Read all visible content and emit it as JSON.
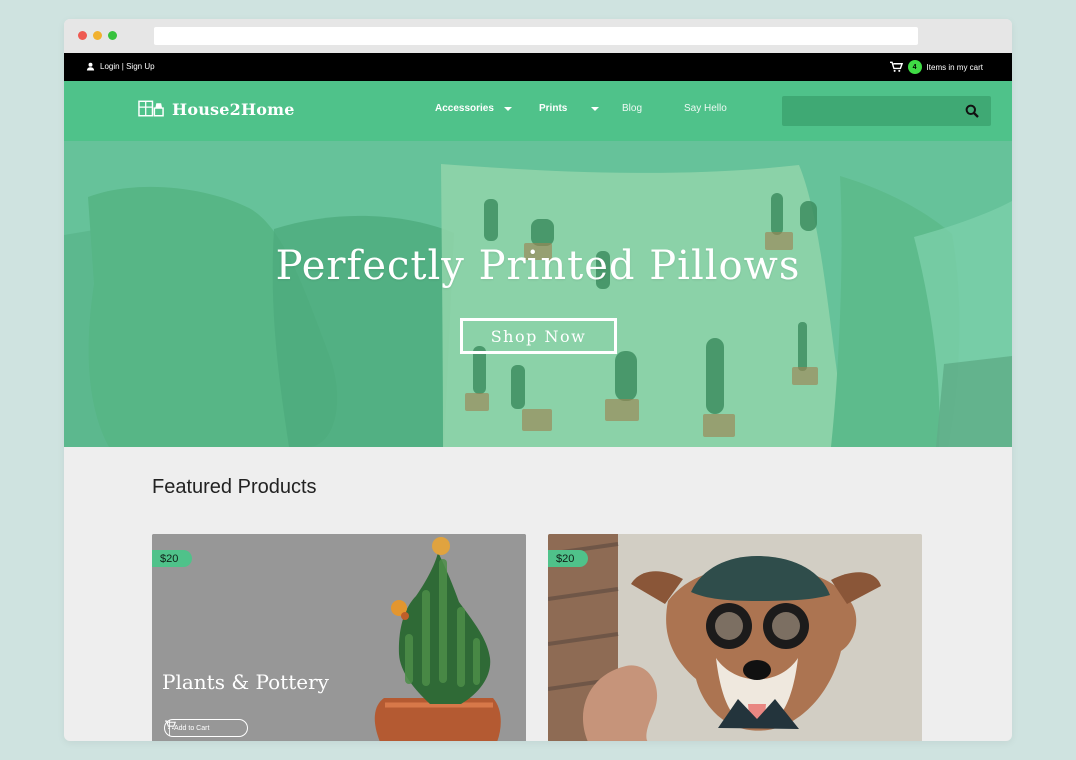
{
  "topbar": {
    "login_signup": "Login | Sign Up",
    "cart_count": "4",
    "cart_label": "Items in my cart"
  },
  "nav": {
    "brand": "House2Home",
    "items": [
      {
        "label": "Accessories",
        "has_dropdown": true
      },
      {
        "label": "Prints",
        "has_dropdown": true
      },
      {
        "label": "Blog",
        "has_dropdown": false
      },
      {
        "label": "Say Hello",
        "has_dropdown": false
      }
    ],
    "search": {
      "placeholder": ""
    }
  },
  "hero": {
    "title": "Perfectly Printed Pillows",
    "button": "Shop Now"
  },
  "featured": {
    "title": "Featured Products",
    "products": [
      {
        "price": "$20",
        "title": "Plants & Pottery",
        "add_to_cart": "Add to Cart"
      },
      {
        "price": "$20",
        "title": "",
        "add_to_cart": ""
      }
    ]
  },
  "colors": {
    "brand_green": "#4fc28a",
    "cart_badge": "#3fdc45",
    "topbar": "#000000"
  },
  "icons": {
    "user": "user-icon",
    "cart": "cart-icon",
    "logo": "furniture-logo-icon",
    "search": "search-icon",
    "dropdown": "chevron-down-icon"
  }
}
